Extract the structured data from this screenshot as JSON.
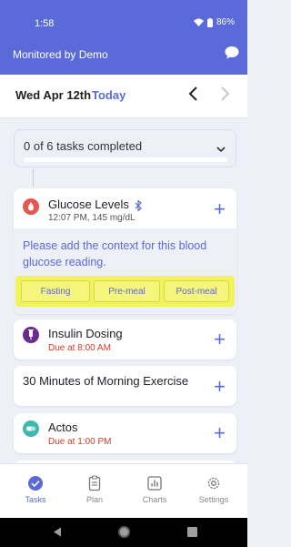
{
  "status_bar": {
    "time": "1:58",
    "battery": "86%"
  },
  "app_bar": {
    "title": "Monitored by Demo"
  },
  "date_nav": {
    "date": "Wed Apr 12th",
    "today": "Today"
  },
  "progress": {
    "label": "0 of 6 tasks completed",
    "completed": 0,
    "total": 6
  },
  "tasks": [
    {
      "title": "Glucose Levels",
      "subtitle": "12:07 PM, 145 mg/dL",
      "icon": "blood-drop-icon",
      "icon_color": "#e8574f",
      "context_message": "Please add the context for this blood glucose reading.",
      "context_buttons": [
        "Fasting",
        "Pre-meal",
        "Post-meal"
      ]
    },
    {
      "title": "Insulin Dosing",
      "subtitle": "Due at 8:00 AM",
      "icon": "syringe-icon",
      "icon_color": "#6a2b8e"
    },
    {
      "title": "30 Minutes of Morning Exercise"
    },
    {
      "title": "Actos",
      "subtitle": "Due at 1:00 PM",
      "icon": "pill-icon",
      "icon_color": "#3fb8b0"
    }
  ],
  "tabs": [
    {
      "label": "Tasks",
      "icon": "check-circle-icon",
      "active": true
    },
    {
      "label": "Plan",
      "icon": "clipboard-icon"
    },
    {
      "label": "Charts",
      "icon": "chart-icon"
    },
    {
      "label": "Settings",
      "icon": "gear-icon"
    }
  ],
  "colors": {
    "primary": "#5a6ad8",
    "due": "#d33b2c",
    "highlight": "#f1f25c"
  }
}
